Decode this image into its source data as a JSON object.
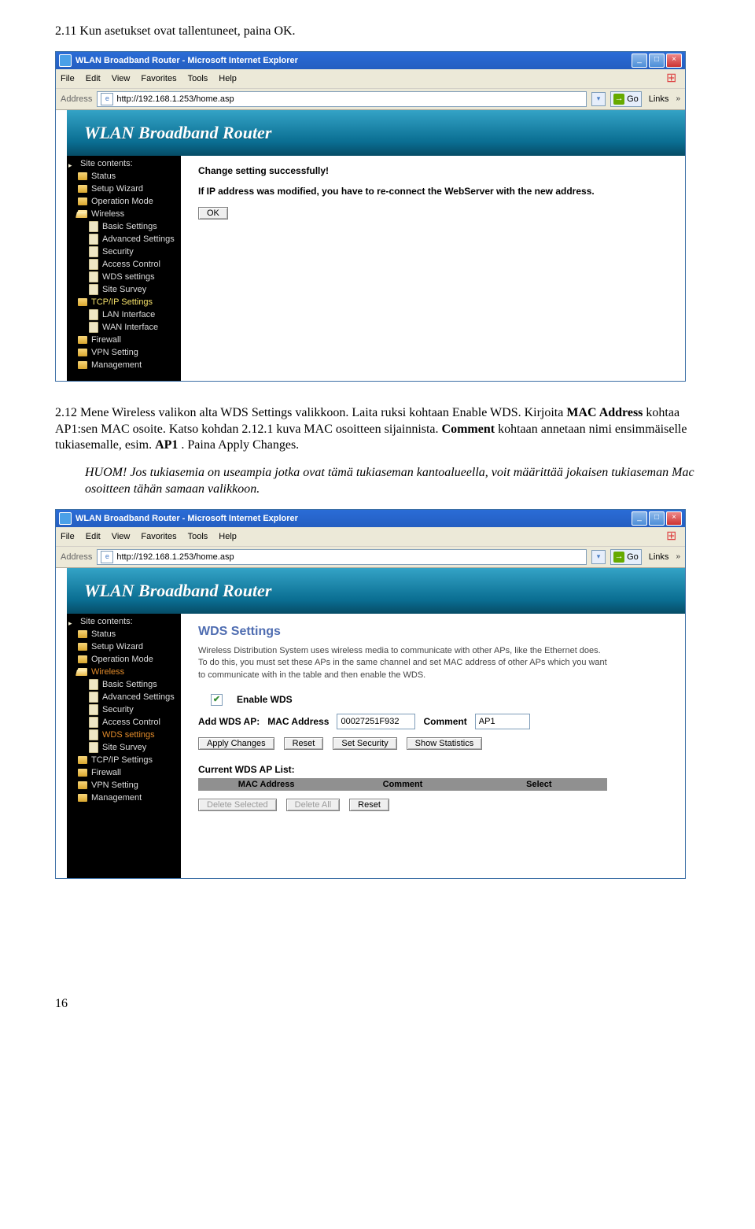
{
  "body": {
    "p1": "2.11 Kun asetukset ovat tallentuneet, paina OK.",
    "p2a": "2.12 Mene Wireless valikon alta WDS Settings valikkoon. Laita ruksi kohtaan Enable WDS. Kirjoita ",
    "p2b": "MAC Address",
    "p2c": " kohtaa AP1:sen MAC osoite. Katso kohdan 2.12.1 kuva MAC osoitteen sijainnista. ",
    "p2d": "Comment",
    "p2e": " kohtaan annetaan nimi ensimmäiselle tukiasemalle, esim. ",
    "p2f": "AP1",
    "p2g": ". Paina Apply Changes.",
    "huom_label": "HUOM!",
    "huom_text": " Jos tukiasemia on useampia jotka ovat tämä tukiaseman kantoalueella, voit määrittää jokaisen tukiaseman Mac osoitteen tähän samaan valikkoon."
  },
  "ie": {
    "title": "WLAN Broadband Router - Microsoft Internet Explorer",
    "menu": {
      "file": "File",
      "edit": "Edit",
      "view": "View",
      "favorites": "Favorites",
      "tools": "Tools",
      "help": "Help"
    },
    "addr_label": "Address",
    "url": "http://192.168.1.253/home.asp",
    "go_label": "Go",
    "links_label": "Links"
  },
  "router": {
    "banner_title": "WLAN Broadband Router",
    "sidebar": {
      "head": "Site contents:",
      "items": [
        {
          "label": "Status",
          "type": "folder"
        },
        {
          "label": "Setup Wizard",
          "type": "folder"
        },
        {
          "label": "Operation Mode",
          "type": "folder"
        },
        {
          "label": "Wireless",
          "type": "open",
          "subs": [
            "Basic Settings",
            "Advanced Settings",
            "Security",
            "Access Control",
            "WDS settings",
            "Site Survey"
          ]
        },
        {
          "label": "TCP/IP Settings",
          "type": "hl_yellow",
          "subs": [
            "LAN Interface",
            "WAN Interface"
          ]
        },
        {
          "label": "Firewall",
          "type": "folder"
        },
        {
          "label": "VPN Setting",
          "type": "folder"
        },
        {
          "label": "Management",
          "type": "folder"
        }
      ]
    },
    "sidebar_ss2": {
      "wireless_hl": "Wireless",
      "wireless_subs": [
        "Basic Settings",
        "Advanced Settings",
        "Security",
        "Access Control"
      ],
      "wds_orange": "WDS settings",
      "wireless_sub_after": [
        "Site Survey"
      ],
      "tcpip": "TCP/IP Settings",
      "rest": [
        "Firewall",
        "VPN Setting",
        "Management"
      ]
    }
  },
  "ss1": {
    "success": "Change setting successfully!",
    "note": "If IP address was modified, you have to re-connect the WebServer with the new address.",
    "ok": "OK"
  },
  "ss2": {
    "heading": "WDS Settings",
    "desc": "Wireless Distribution System uses wireless media to communicate with other APs, like the Ethernet does. To do this, you must set these APs in the same channel and set MAC address of other APs which you want to communicate with in the table and then enable the WDS.",
    "enable_label": "Enable WDS",
    "addap_label": "Add WDS AP:",
    "mac_label": "MAC Address",
    "mac_value": "00027251F932",
    "comment_label": "Comment",
    "comment_value": "AP1",
    "btn_apply": "Apply Changes",
    "btn_reset": "Reset",
    "btn_sec": "Set Security",
    "btn_stat": "Show Statistics",
    "list_title": "Current WDS AP List:",
    "th_mac": "MAC Address",
    "th_comment": "Comment",
    "th_select": "Select",
    "btn_delsel": "Delete Selected",
    "btn_delall": "Delete All"
  },
  "page_number": "16"
}
